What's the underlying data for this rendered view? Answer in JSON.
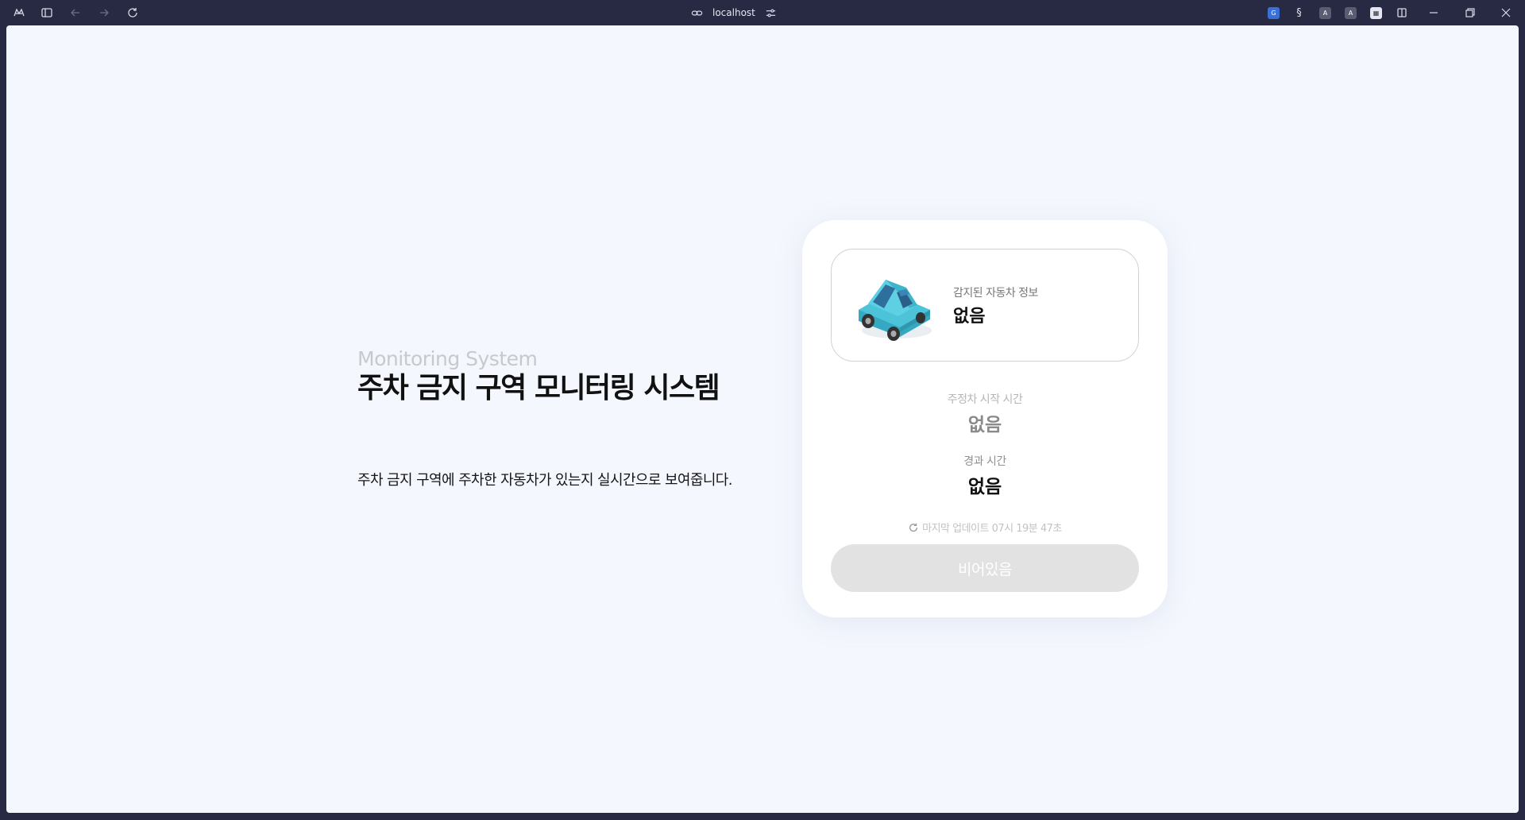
{
  "browser": {
    "url": "localhost"
  },
  "page": {
    "subtitle": "Monitoring System",
    "title": "주차 금지 구역 모니터링 시스템",
    "description": "주차 금지 구역에 주차한 자동차가 있는지 실시간으로 보여줍니다."
  },
  "card": {
    "detected_label": "감지된 자동차 정보",
    "detected_value": "없음",
    "parking_start_label": "주정차 시작 시간",
    "parking_start_value": "없음",
    "elapsed_label": "경과 시간",
    "elapsed_value": "없음",
    "last_update": "마지막 업데이트 07시 19분 47초",
    "status_button": "비어있음"
  },
  "colors": {
    "page_bg": "#f4f7fd",
    "chrome_bg": "#282a43",
    "car_body": "#4cc3d9",
    "button_bg": "#e2e2e2"
  }
}
